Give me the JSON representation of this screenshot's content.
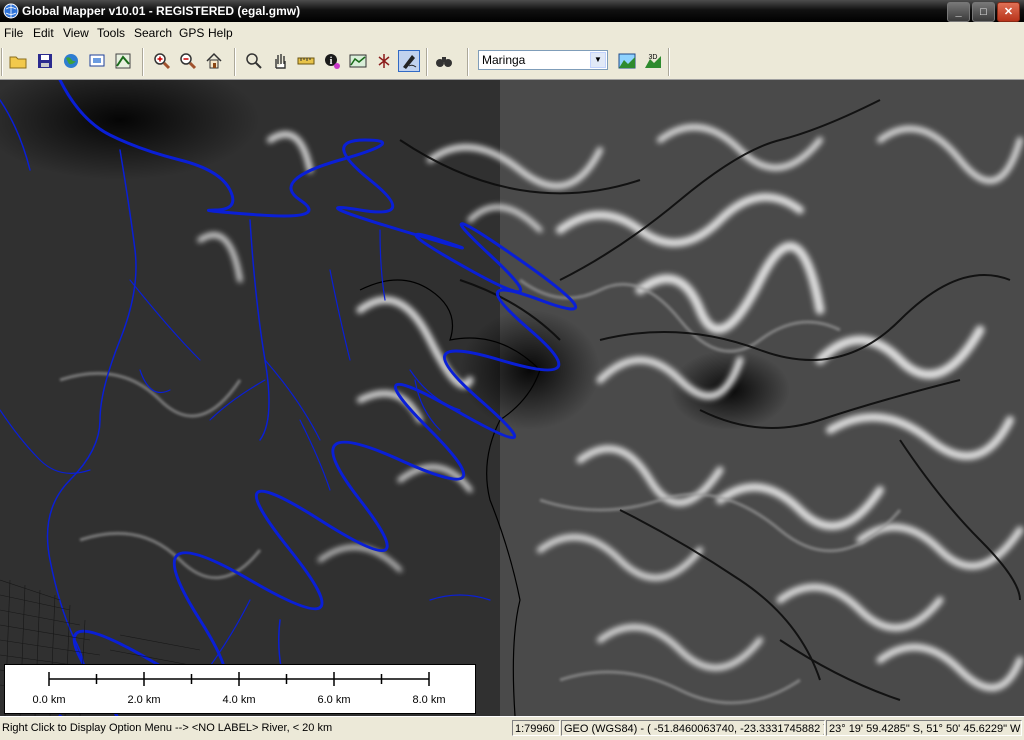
{
  "window": {
    "title": "Global Mapper v10.01 - REGISTERED (egal.gmw)",
    "buttons": {
      "minimize": "_",
      "maximize": "□",
      "close": "✕"
    }
  },
  "menu": [
    "File",
    "Edit",
    "View",
    "Tools",
    "Search",
    "GPS",
    "Help"
  ],
  "toolbar": {
    "buttons": [
      {
        "icon": "open-folder-icon"
      },
      {
        "icon": "save-icon"
      },
      {
        "icon": "globe-icon"
      },
      {
        "icon": "digitizer-icon"
      },
      {
        "icon": "overlay-control-icon"
      },
      {
        "icon": "zoom-in-icon"
      },
      {
        "icon": "zoom-out-icon"
      },
      {
        "icon": "home-icon"
      },
      {
        "icon": "zoom-tool-icon"
      },
      {
        "icon": "pan-hand-icon"
      },
      {
        "icon": "measure-ruler-icon"
      },
      {
        "icon": "feature-info-icon"
      },
      {
        "icon": "path-profile-icon"
      },
      {
        "icon": "view-shed-icon"
      },
      {
        "icon": "digitizer-pen-icon"
      },
      {
        "icon": "binoculars-icon"
      }
    ],
    "place_select": {
      "value": "Maringa"
    },
    "extra_buttons": [
      {
        "icon": "terrain-2d-icon"
      },
      {
        "icon": "terrain-3d-icon",
        "text": "3D"
      }
    ]
  },
  "scalebar": {
    "labels": [
      "0.0 km",
      "2.0 km",
      "4.0 km",
      "6.0 km",
      "8.0 km"
    ]
  },
  "statusbar": {
    "message": "Right Click to Display Option Menu --> <NO LABEL> River, < 20 km",
    "scale": "1:79960",
    "coords": "GEO (WGS84) - ( -51.8460063740, -23.3331745882 )",
    "dms": "23° 19' 59.4285\" S, 51° 50' 45.6229\" W"
  },
  "colors": {
    "river": "#0a1fd6",
    "titlebar": "#000000",
    "chrome": "#ece9d8"
  }
}
